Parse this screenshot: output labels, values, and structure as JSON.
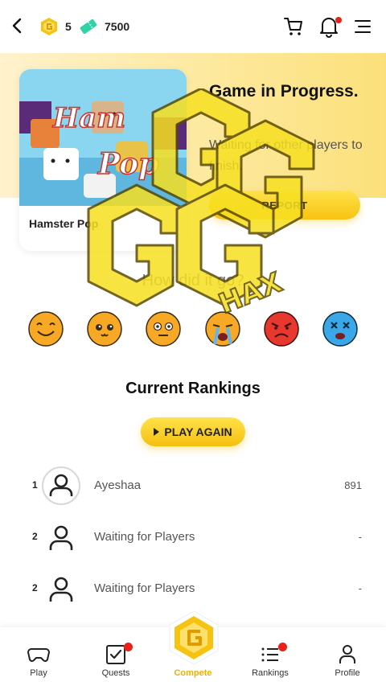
{
  "header": {
    "back_icon": "chevron-left-icon",
    "coins": "5",
    "tickets": "7500",
    "cart_icon": "cart-icon",
    "bell_icon": "bell-icon",
    "menu_icon": "hamburger-icon"
  },
  "game": {
    "name": "Hamster Pop",
    "status_title": "Game in Progress.",
    "status_sub": "Waiting for other players to finish.",
    "report_label": "REPORT"
  },
  "feedback": {
    "question": "How did it go?",
    "emojis": [
      "happy",
      "cute",
      "neutral",
      "crying",
      "angry",
      "dead"
    ]
  },
  "rankings": {
    "title": "Current Rankings",
    "play_again": "PLAY AGAIN",
    "rows": [
      {
        "rank": "1",
        "name": "Ayeshaa",
        "score": "891"
      },
      {
        "rank": "2",
        "name": "Waiting for Players",
        "score": "-"
      },
      {
        "rank": "2",
        "name": "Waiting for Players",
        "score": "-"
      }
    ]
  },
  "nav": [
    {
      "label": "Play"
    },
    {
      "label": "Quests"
    },
    {
      "label": "Compete"
    },
    {
      "label": "Rankings"
    },
    {
      "label": "Profile"
    }
  ],
  "watermark_text": "HAX",
  "colors": {
    "accent": "#f7c312",
    "active_nav": "#f0b000",
    "notification": "#e8211a"
  }
}
